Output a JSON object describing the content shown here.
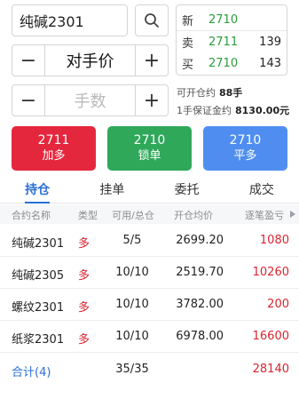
{
  "order": {
    "symbol": "纯碱2301",
    "price_mode": "对手价",
    "qty_placeholder": "手数",
    "minus": "−",
    "plus": "+"
  },
  "quote": {
    "rows": [
      {
        "label": "新",
        "price": "2710",
        "vol": ""
      },
      {
        "label": "卖",
        "price": "2711",
        "vol": "139"
      },
      {
        "label": "买",
        "price": "2710",
        "vol": "143"
      }
    ]
  },
  "info": {
    "open_label": "可开仓约",
    "open_value": "88手",
    "margin_label": "1手保证金约",
    "margin_value": "8130.00元"
  },
  "actions": {
    "buy": {
      "price": "2711",
      "label": "加多"
    },
    "lock": {
      "price": "2710",
      "label": "锁单"
    },
    "close": {
      "price": "2710",
      "label": "平多"
    }
  },
  "tabs": [
    "持仓",
    "挂单",
    "委托",
    "成交"
  ],
  "table": {
    "headers": [
      "合约名称",
      "类型",
      "可用/总仓",
      "开仓均价",
      "逐笔盈亏"
    ],
    "rows": [
      {
        "name": "纯碱2301",
        "type": "多",
        "qty": "5/5",
        "price": "2699.20",
        "pnl": "1080"
      },
      {
        "name": "纯碱2305",
        "type": "多",
        "qty": "10/10",
        "price": "2519.70",
        "pnl": "10260"
      },
      {
        "name": "螺纹2301",
        "type": "多",
        "qty": "10/10",
        "price": "3782.00",
        "pnl": "200"
      },
      {
        "name": "纸浆2301",
        "type": "多",
        "qty": "10/10",
        "price": "6978.00",
        "pnl": "16600"
      }
    ],
    "total": {
      "label": "合计(4)",
      "qty": "35/35",
      "pnl": "28140"
    }
  },
  "colors": {
    "buy": "#e5273d",
    "lock": "#2fa85a",
    "close": "#4f8ef0",
    "accent": "#2a6fd6",
    "up": "#d9242f",
    "quote_green": "#2a9d3a"
  }
}
